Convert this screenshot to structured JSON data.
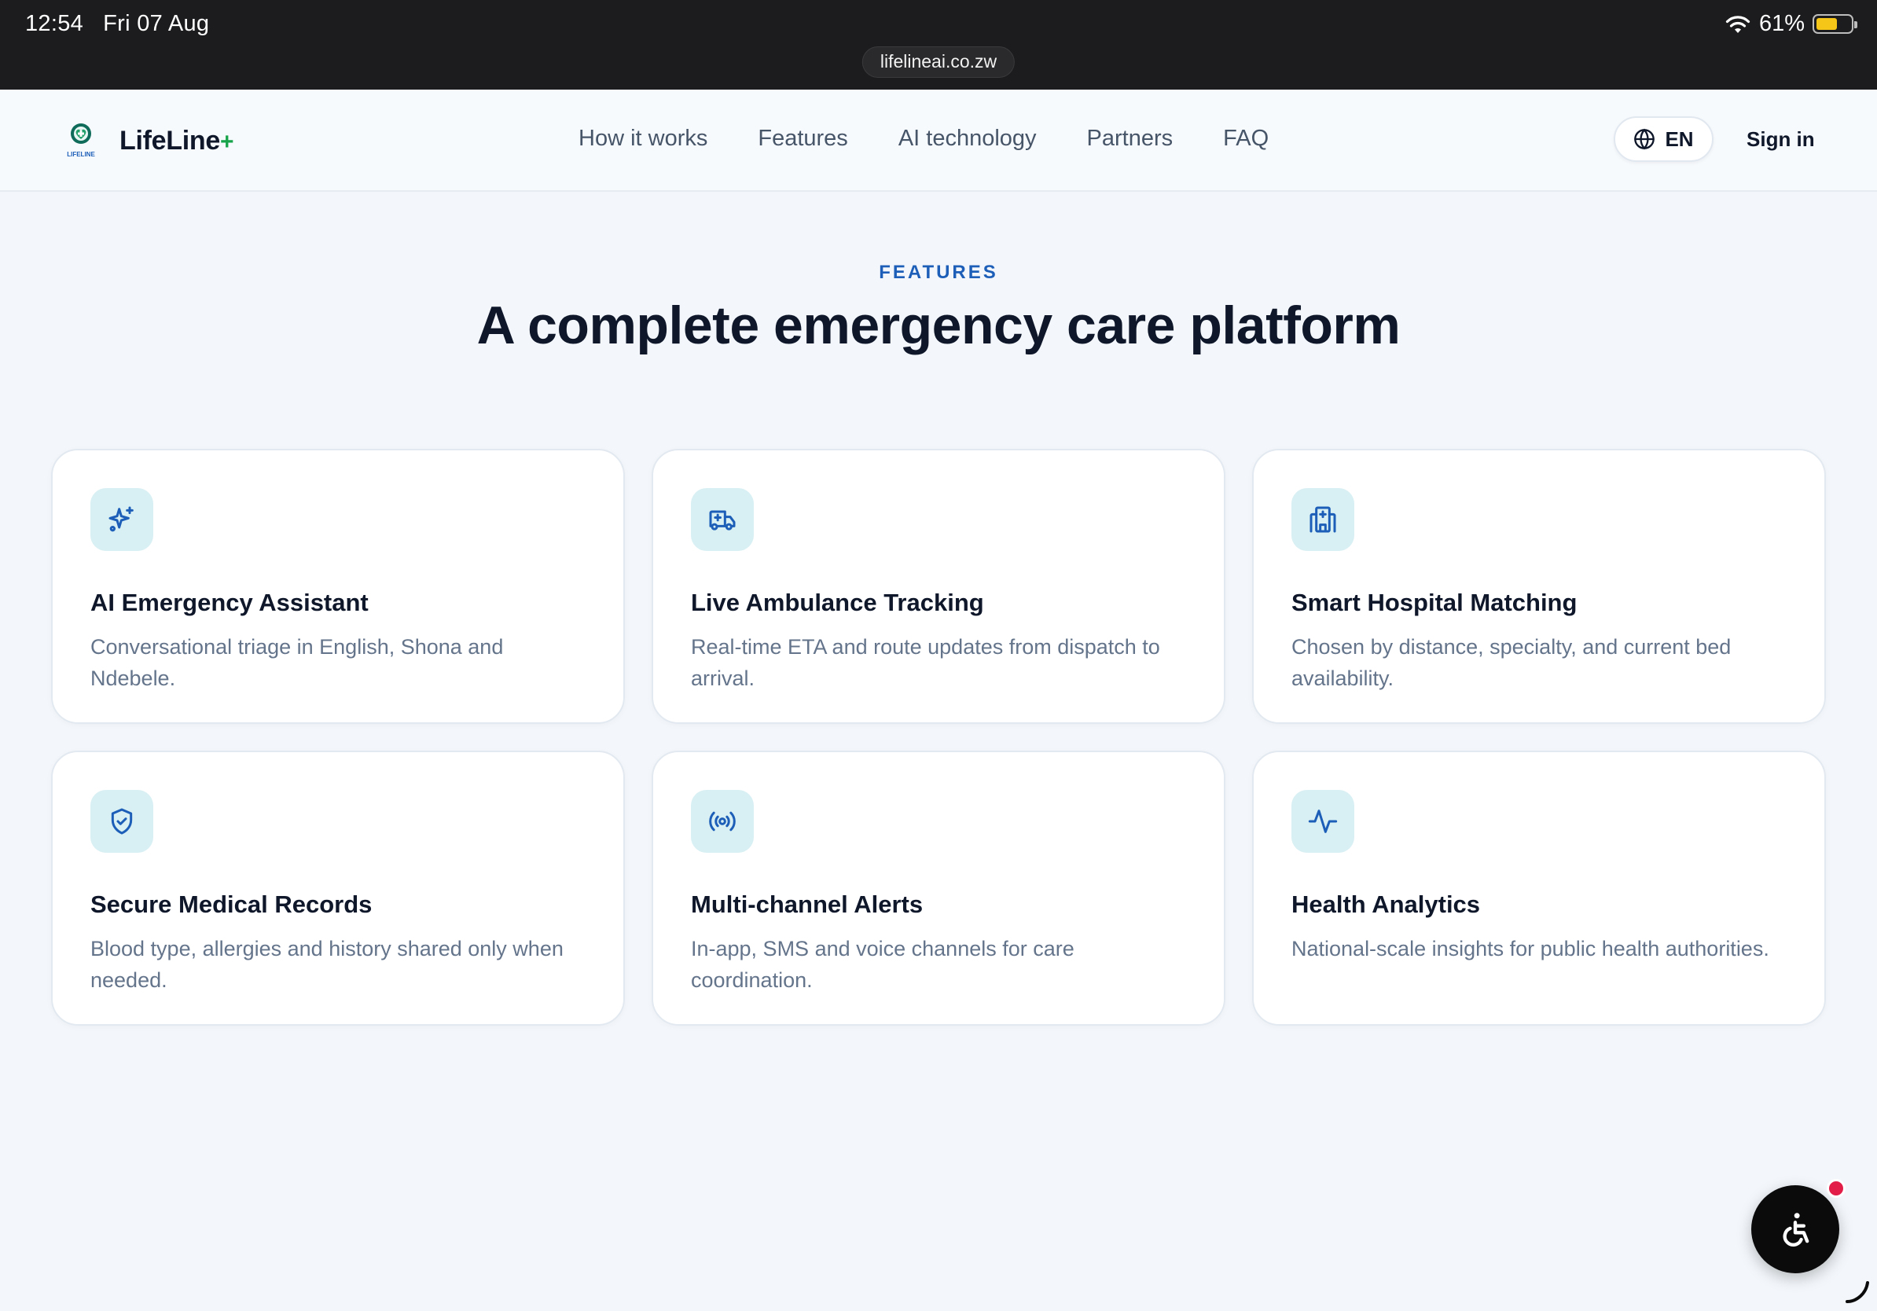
{
  "statusbar": {
    "time": "12:54",
    "date": "Fri 07 Aug",
    "battery": "61%",
    "battery_level": 0.61,
    "url": "lifelineai.co.zw"
  },
  "nav": {
    "brand": "LifeLine",
    "brand_suffix": "+",
    "logo_text": "LIFELINE",
    "links": [
      "How it works",
      "Features",
      "AI technology",
      "Partners",
      "FAQ"
    ],
    "language": "EN",
    "signin": "Sign in"
  },
  "section": {
    "eyebrow": "FEATURES",
    "headline": "A complete emergency care platform"
  },
  "features": [
    {
      "icon": "sparkles-icon",
      "title": "AI Emergency Assistant",
      "desc": "Conversational triage in English, Shona and Ndebele."
    },
    {
      "icon": "ambulance-icon",
      "title": "Live Ambulance Tracking",
      "desc": "Real-time ETA and route updates from dispatch to arrival."
    },
    {
      "icon": "hospital-icon",
      "title": "Smart Hospital Matching",
      "desc": "Chosen by distance, specialty, and current bed availability."
    },
    {
      "icon": "shield-check-icon",
      "title": "Secure Medical Records",
      "desc": "Blood type, allergies and history shared only when needed."
    },
    {
      "icon": "radio-broadcast-icon",
      "title": "Multi-channel Alerts",
      "desc": "In-app, SMS and voice channels for care coordination."
    },
    {
      "icon": "activity-pulse-icon",
      "title": "Health Analytics",
      "desc": "National-scale insights for public health authorities."
    }
  ],
  "colors": {
    "accent": "#1d5fb8",
    "icon_bg": "#d8f0f3",
    "brand_plus": "#16a34a",
    "notification": "#e11d48"
  }
}
